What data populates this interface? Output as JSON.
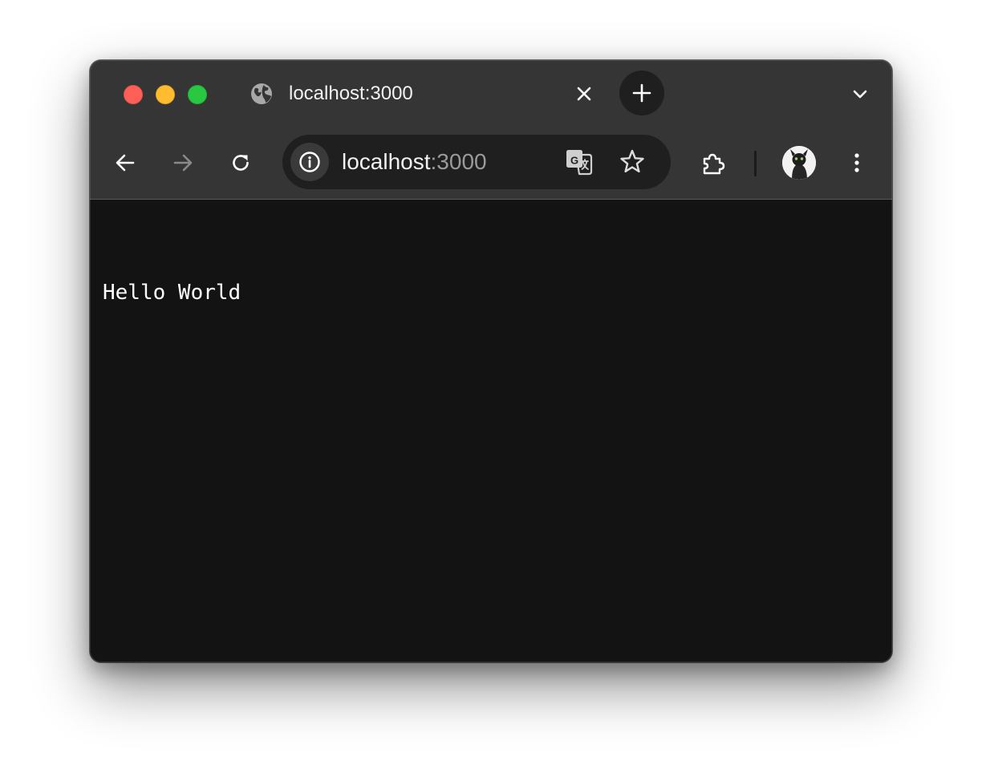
{
  "window": {
    "traffic_lights": [
      "close",
      "minimize",
      "zoom"
    ]
  },
  "tab": {
    "title": "localhost:3000",
    "favicon": "globe-icon",
    "close_icon": "close-icon"
  },
  "titlebar": {
    "new_tab_icon": "plus-icon",
    "tab_search_icon": "chevron-down-icon"
  },
  "toolbar": {
    "back_icon": "arrow-left-icon",
    "forward_icon": "arrow-right-icon",
    "reload_icon": "reload-icon",
    "extensions_icon": "puzzle-icon",
    "menu_icon": "more-vertical-icon"
  },
  "omnibox": {
    "host": "localhost",
    "port": ":3000",
    "site_info_icon": "info-icon",
    "translate_icon": "translate-icon",
    "bookmark_icon": "star-icon"
  },
  "page": {
    "text": "Hello World"
  },
  "colors": {
    "titlebar_bg": "#353535",
    "content_bg": "#131313",
    "omnibox_bg": "#1f1f1f",
    "close": "#fe5f57",
    "minimize": "#febc2e",
    "zoom": "#28c840"
  }
}
